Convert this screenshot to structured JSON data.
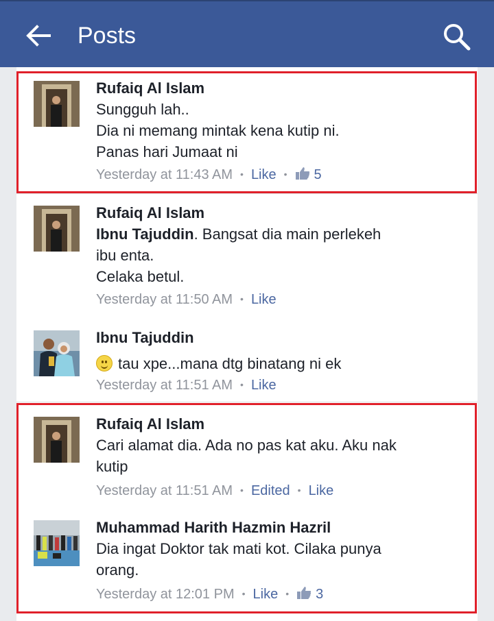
{
  "appbar": {
    "title": "Posts",
    "back_icon": "arrow-left-icon",
    "search_icon": "search-icon",
    "color": "#3b5998"
  },
  "highlight_color": "#e0202a",
  "comments": [
    {
      "author": "Rufaiq Al Islam",
      "lines": [
        "Sungguh lah..",
        "Dia ni memang mintak kena kutip ni.",
        "Panas hari Jumaat ni"
      ],
      "time": "Yesterday at 11:43 AM",
      "like_label": "Like",
      "like_count": "5"
    },
    {
      "author": "Rufaiq Al Islam",
      "mention": "Ibnu Tajuddin",
      "lines": [
        ". Bangsat dia main perlekeh",
        "ibu enta.",
        "Celaka betul."
      ],
      "time": "Yesterday at 11:50 AM",
      "like_label": "Like"
    },
    {
      "author": "Ibnu Tajuddin",
      "emoji": "smile-emoji-icon",
      "lines": [
        "tau xpe...mana dtg binatang ni ek"
      ],
      "time": "Yesterday at 11:51 AM",
      "like_label": "Like"
    },
    {
      "author": "Rufaiq Al Islam",
      "lines": [
        "Cari alamat dia. Ada no pas kat aku. Aku nak",
        "kutip"
      ],
      "time": "Yesterday at 11:51 AM",
      "edited_label": "Edited",
      "like_label": "Like"
    },
    {
      "author": "Muhammad Harith Hazmin Hazril",
      "lines": [
        "Dia ingat Doktor tak mati kot. Cilaka punya",
        "orang."
      ],
      "time": "Yesterday at 12:01 PM",
      "like_label": "Like",
      "like_count": "3"
    }
  ]
}
